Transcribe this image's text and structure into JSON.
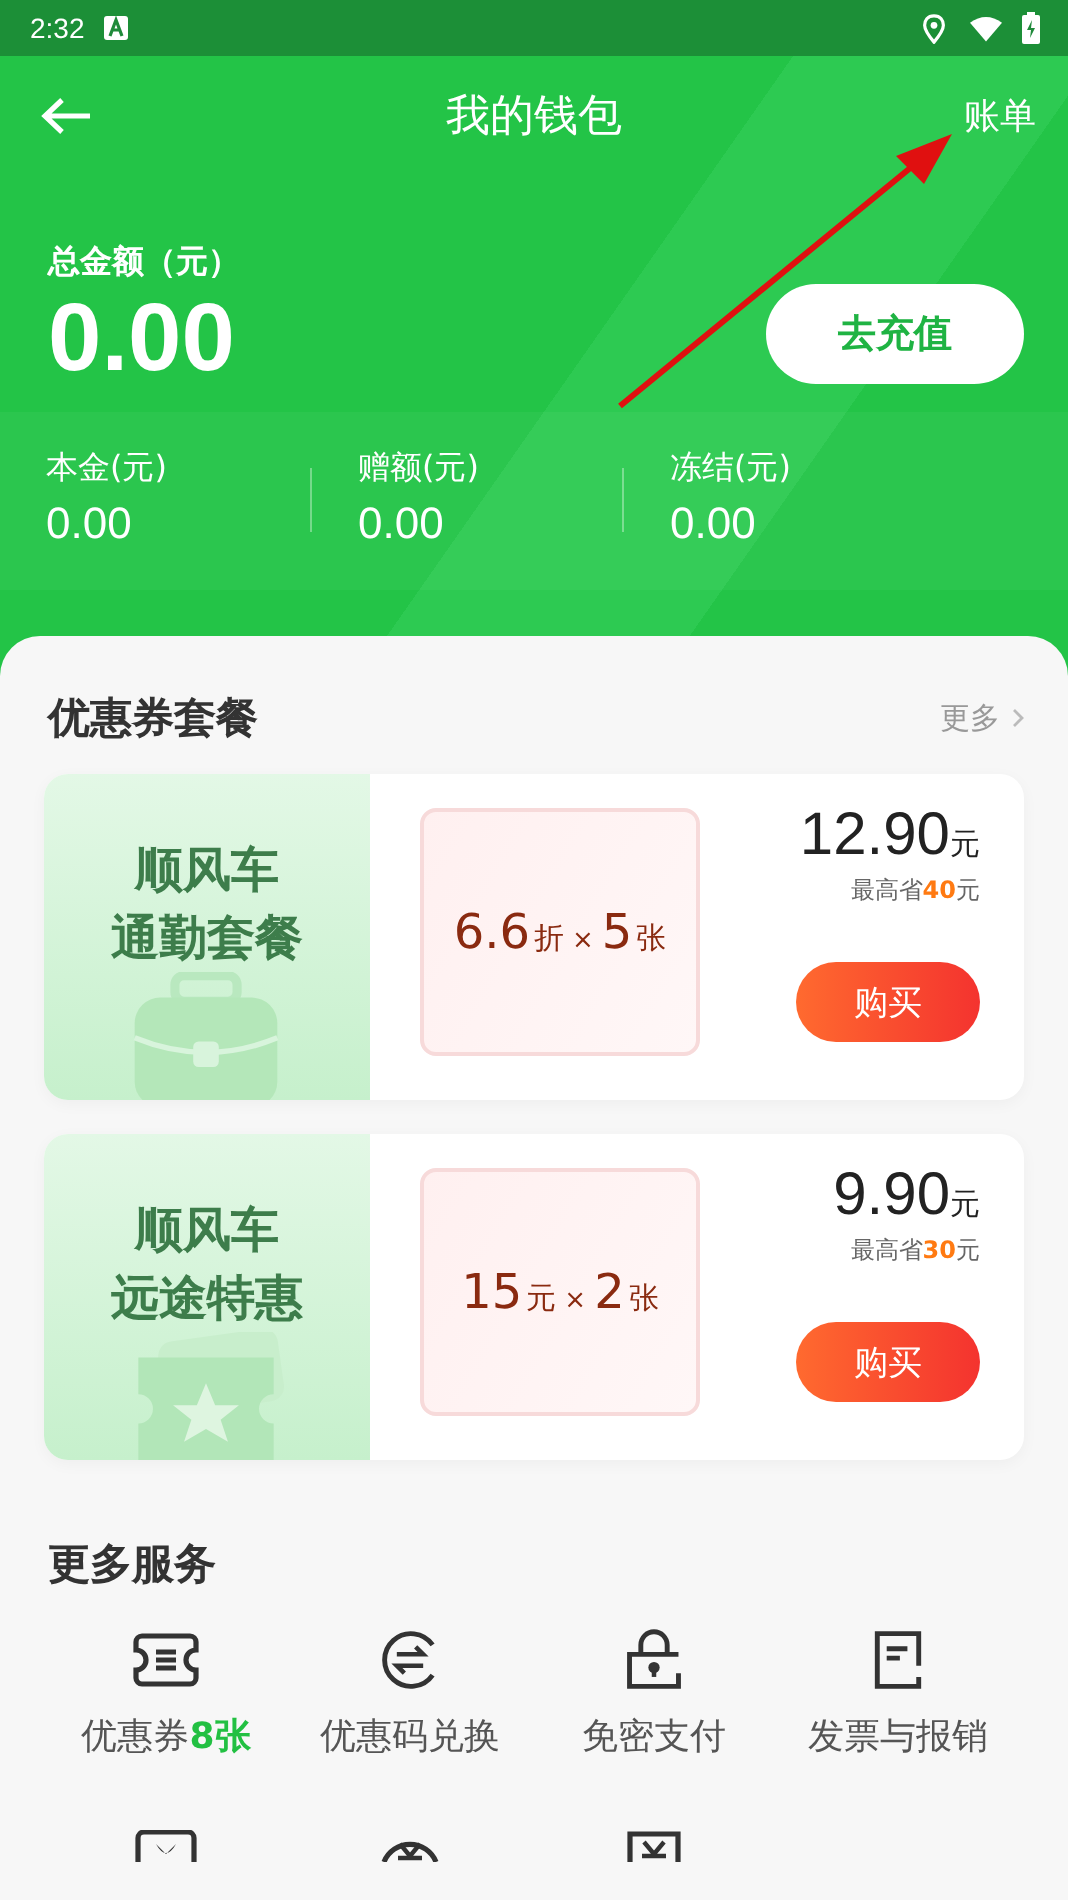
{
  "status_bar": {
    "time": "2:32"
  },
  "header": {
    "title": "我的钱包",
    "action": "账单"
  },
  "balance": {
    "label": "总金额（元）",
    "amount": "0.00",
    "button": "去充值"
  },
  "breakdown": [
    {
      "label": "本金(元)",
      "value": "0.00"
    },
    {
      "label": "赠额(元)",
      "value": "0.00"
    },
    {
      "label": "冻结(元)",
      "value": "0.00"
    }
  ],
  "coupons": {
    "title": "优惠券套餐",
    "more": "更多",
    "packages": [
      {
        "kind": "briefcase",
        "name_line1": "顺风车",
        "name_line2": "通勤套餐",
        "value": "6.6",
        "unit": "折",
        "times": "×",
        "count": "5",
        "count_unit": "张",
        "price": "12.90",
        "price_unit": "元",
        "save_prefix": "最高省",
        "save_amount": "40",
        "save_unit": "元",
        "button": "购买"
      },
      {
        "kind": "ticket",
        "name_line1": "顺风车",
        "name_line2": "远途特惠",
        "value": "15",
        "unit": "元",
        "times": "×",
        "count": "2",
        "count_unit": "张",
        "price": "9.90",
        "price_unit": "元",
        "save_prefix": "最高省",
        "save_amount": "30",
        "save_unit": "元",
        "button": "购买"
      }
    ]
  },
  "services": {
    "title": "更多服务",
    "items": [
      {
        "kind": "coupon",
        "label": "优惠券",
        "badge": "8张"
      },
      {
        "kind": "exchange",
        "label": "优惠码兑换"
      },
      {
        "kind": "lock",
        "label": "免密支付"
      },
      {
        "kind": "invoice",
        "label": "发票与报销"
      }
    ]
  }
}
